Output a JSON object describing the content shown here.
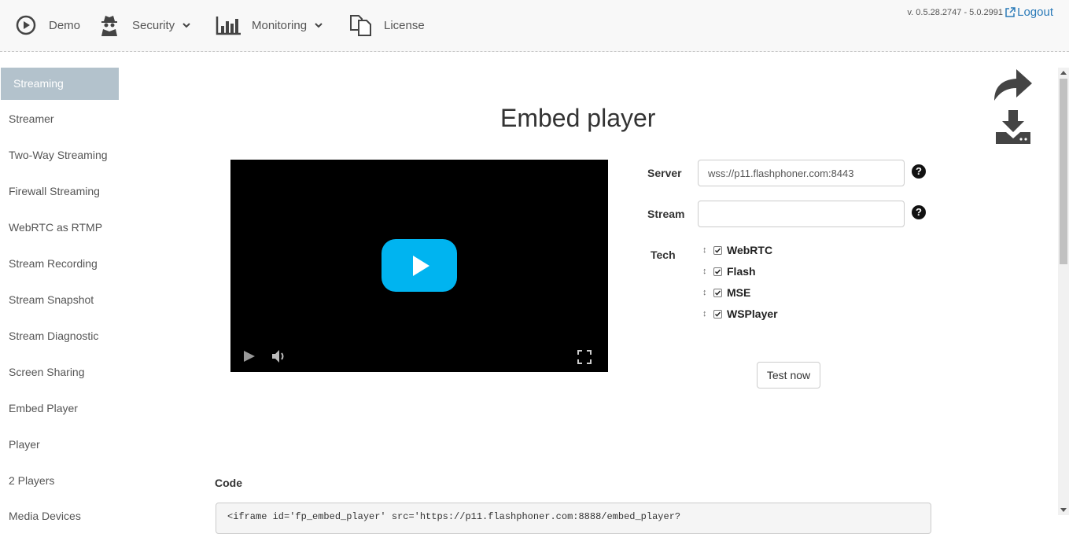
{
  "nav": {
    "items": [
      {
        "label": "Demo",
        "icon": "play-circle-icon"
      },
      {
        "label": "Security",
        "icon": "spy-icon"
      },
      {
        "label": "Monitoring",
        "icon": "bar-chart-icon"
      },
      {
        "label": "License",
        "icon": "documents-icon"
      }
    ],
    "version": "v. 0.5.28.2747 - 5.0.2991",
    "logout": "Logout"
  },
  "sidebar": {
    "active": "Streaming",
    "items": [
      "Streamer",
      "Two-Way Streaming",
      "Firewall Streaming",
      "WebRTC as RTMP",
      "Stream Recording",
      "Stream Snapshot",
      "Stream Diagnostic",
      "Screen Sharing",
      "Embed Player",
      "Player",
      "2 Players",
      "Media Devices"
    ]
  },
  "main": {
    "title": "Embed player",
    "server_label": "Server",
    "server_value": "wss://p11.flashphoner.com:8443",
    "stream_label": "Stream",
    "stream_value": "",
    "help": "?",
    "tech_label": "Tech",
    "techs": [
      "WebRTC",
      "Flash",
      "MSE",
      "WSPlayer"
    ],
    "drag_glyph": "↕",
    "test_button": "Test now",
    "code_label": "Code",
    "code_value": "<iframe id='fp_embed_player' src='https://p11.flashphoner.com:8888/embed_player?"
  },
  "colors": {
    "play_button": "#00b4f0",
    "active_sidebar": "#b3c2cc",
    "logout_link": "#2a7ab8"
  }
}
